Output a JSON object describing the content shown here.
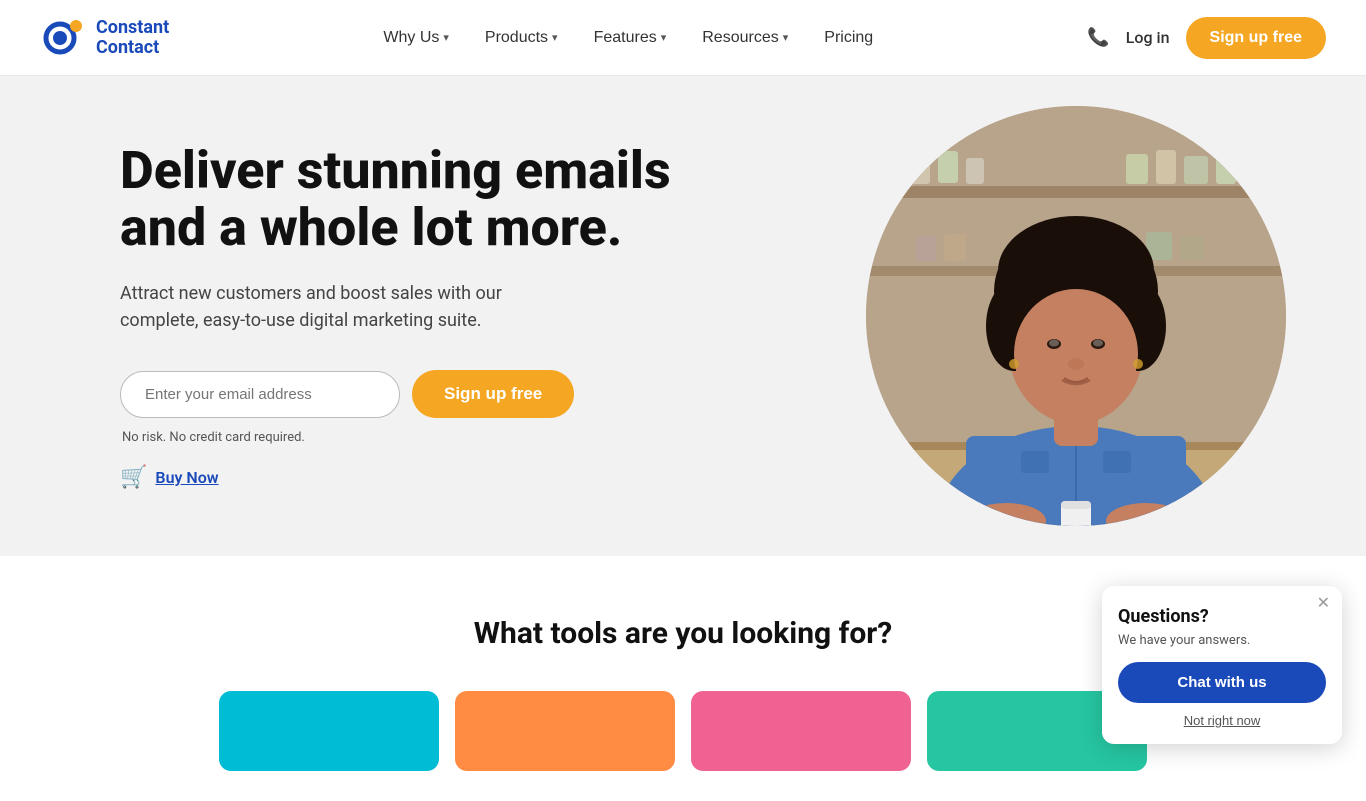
{
  "brand": {
    "name_line1": "Constant",
    "name_line2": "Contact"
  },
  "nav": {
    "why_us": "Why Us",
    "products": "Products",
    "features": "Features",
    "resources": "Resources",
    "pricing": "Pricing",
    "login": "Log in",
    "signup": "Sign up free"
  },
  "hero": {
    "title": "Deliver stunning emails and a whole lot more.",
    "subtitle": "Attract new customers and boost sales with our complete, easy-to-use digital marketing suite.",
    "email_placeholder": "Enter your email address",
    "signup_btn": "Sign up free",
    "no_risk": "No risk. No credit card required.",
    "buy_now": "Buy Now"
  },
  "section2": {
    "title": "What tools are you looking for?"
  },
  "chat": {
    "title": "Questions?",
    "subtitle": "We have your answers.",
    "chat_btn": "Chat with us",
    "not_now": "Not right now"
  }
}
